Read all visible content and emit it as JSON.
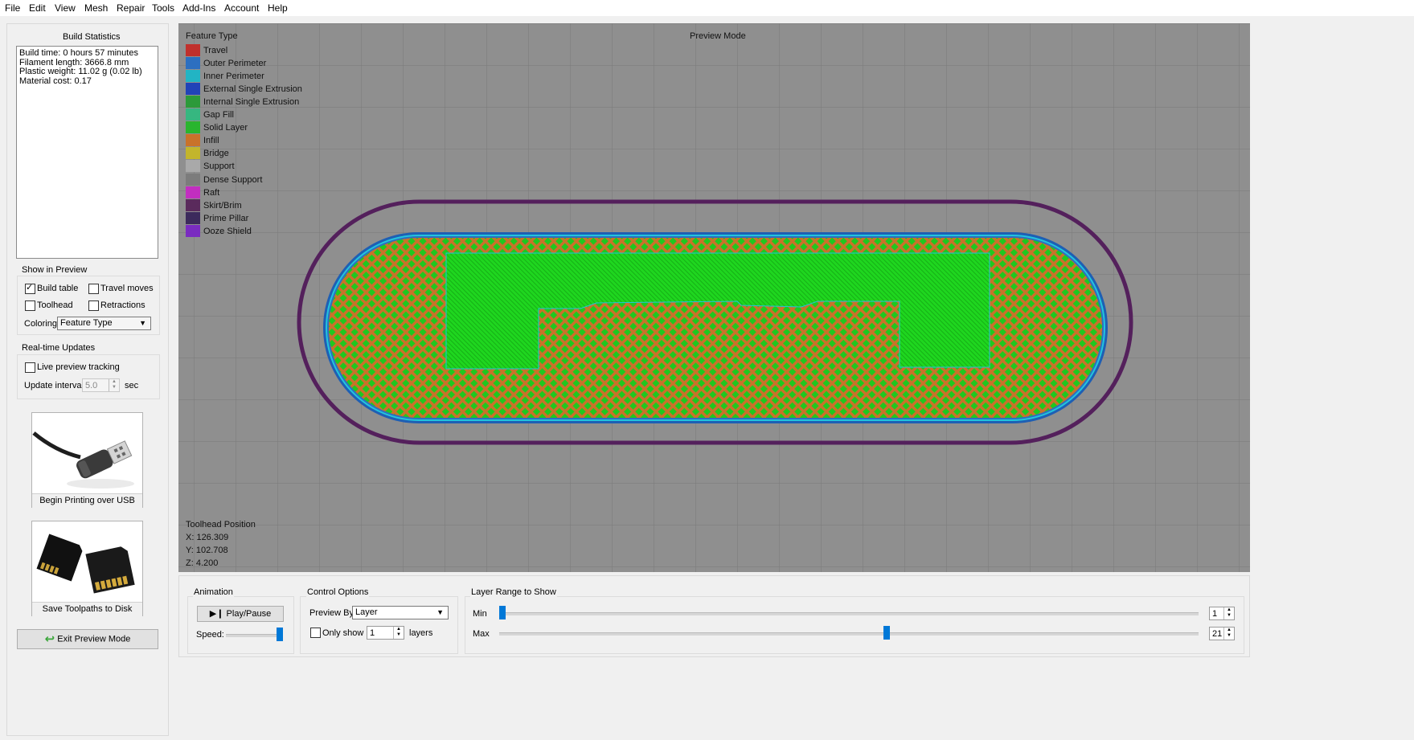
{
  "menu": [
    "File",
    "Edit",
    "View",
    "Mesh",
    "Repair",
    "Tools",
    "Add-Ins",
    "Account",
    "Help"
  ],
  "build_stats": {
    "title": "Build Statistics",
    "lines": [
      "Build time: 0 hours 57 minutes",
      "Filament length: 3666.8 mm",
      "Plastic weight: 11.02 g (0.02 lb)",
      "Material cost: 0.17"
    ]
  },
  "show_in_preview": {
    "title": "Show in Preview",
    "build_table": {
      "label": "Build table",
      "checked": true
    },
    "travel_moves": {
      "label": "Travel moves",
      "checked": false
    },
    "toolhead": {
      "label": "Toolhead",
      "checked": false
    },
    "retractions": {
      "label": "Retractions",
      "checked": false
    },
    "coloring_label": "Coloring",
    "coloring_value": "Feature Type"
  },
  "realtime": {
    "title": "Real-time Updates",
    "live_label": "Live preview tracking",
    "interval_label": "Update interval",
    "interval_value": "5.0",
    "interval_unit": "sec"
  },
  "actions": {
    "usb_label": "Begin Printing over USB",
    "disk_label": "Save Toolpaths to Disk",
    "exit_label": "Exit Preview Mode"
  },
  "viewport": {
    "legend_title": "Feature Type",
    "mode_label": "Preview Mode",
    "legend": [
      {
        "label": "Travel",
        "color": "#c0302c"
      },
      {
        "label": "Outer Perimeter",
        "color": "#2c6fc0"
      },
      {
        "label": "Inner Perimeter",
        "color": "#22b4c4"
      },
      {
        "label": "External Single Extrusion",
        "color": "#2143b8"
      },
      {
        "label": "Internal Single Extrusion",
        "color": "#2c9a3a"
      },
      {
        "label": "Gap Fill",
        "color": "#36b780"
      },
      {
        "label": "Solid Layer",
        "color": "#29b52e"
      },
      {
        "label": "Infill",
        "color": "#c9722a"
      },
      {
        "label": "Bridge",
        "color": "#c3b52c"
      },
      {
        "label": "Support",
        "color": "#a9a9a9"
      },
      {
        "label": "Dense Support",
        "color": "#7c7c7c"
      },
      {
        "label": "Raft",
        "color": "#c22ec0"
      },
      {
        "label": "Skirt/Brim",
        "color": "#5a2a5c"
      },
      {
        "label": "Prime Pillar",
        "color": "#3c2a5c"
      },
      {
        "label": "Ooze Shield",
        "color": "#7a2cc0"
      }
    ],
    "toolhead_title": "Toolhead Position",
    "toolhead_x": "X: 126.309",
    "toolhead_y": "Y: 102.708",
    "toolhead_z": "Z: 4.200"
  },
  "animation": {
    "title": "Animation",
    "play_label": "Play/Pause",
    "speed_label": "Speed:"
  },
  "control_options": {
    "title": "Control Options",
    "preview_by_label": "Preview By",
    "preview_by_value": "Layer",
    "only_show_label": "Only show",
    "only_show_value": "1",
    "layers_label": "layers"
  },
  "layer_range": {
    "title": "Layer Range to Show",
    "min_label": "Min",
    "max_label": "Max",
    "min_value": "1",
    "max_value": "21"
  },
  "colors": {
    "infill": "#c9722a",
    "solid": "#1fd61f",
    "perimeter_outer": "#2c6fc0",
    "perimeter_inner": "#22c4dc",
    "skirt": "#5a2060",
    "accent": "#0078d7"
  }
}
